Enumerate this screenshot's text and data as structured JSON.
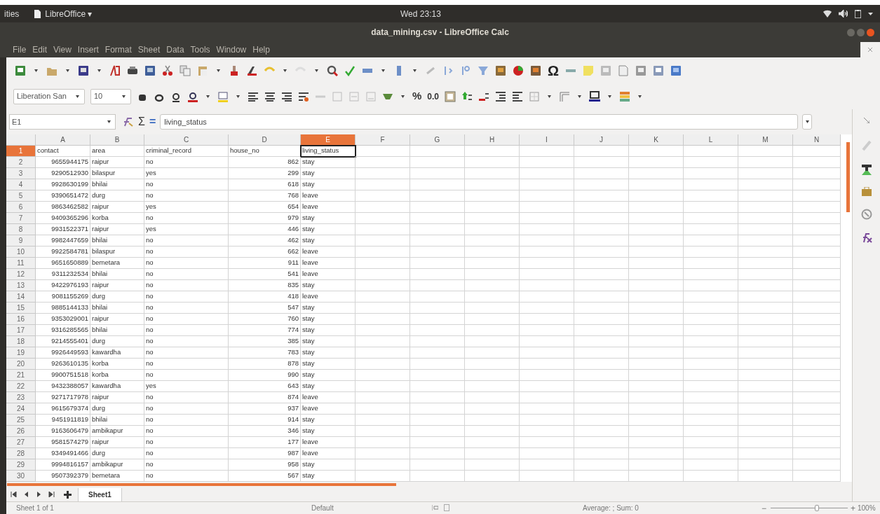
{
  "top_panel": {
    "activities": "ities",
    "app_menu": "LibreOffice ▾",
    "clock": "Wed 23:13"
  },
  "window": {
    "title": "data_mining.csv - LibreOffice Calc"
  },
  "menu": [
    "File",
    "Edit",
    "View",
    "Insert",
    "Format",
    "Sheet",
    "Data",
    "Tools",
    "Window",
    "Help"
  ],
  "toolbar": {
    "special_character": "Ω",
    "font_name": "Liberation San",
    "font_size": "10",
    "percent": "%",
    "decimal": "0.0"
  },
  "formula_bar": {
    "cell_reference": "E1",
    "sum_symbol": "Σ",
    "equals_symbol": "=",
    "content": "living_status"
  },
  "columns": [
    {
      "label": "A",
      "selected": false
    },
    {
      "label": "B",
      "selected": false
    },
    {
      "label": "C",
      "selected": false
    },
    {
      "label": "D",
      "selected": false
    },
    {
      "label": "E",
      "selected": true
    },
    {
      "label": "F",
      "selected": false
    },
    {
      "label": "G",
      "selected": false
    },
    {
      "label": "H",
      "selected": false
    },
    {
      "label": "I",
      "selected": false
    },
    {
      "label": "J",
      "selected": false
    },
    {
      "label": "K",
      "selected": false
    },
    {
      "label": "L",
      "selected": false
    },
    {
      "label": "M",
      "selected": false
    },
    {
      "label": "N",
      "selected": false
    }
  ],
  "rows": [
    {
      "number": "1",
      "selected": true,
      "kind": "header",
      "cells": [
        "contact",
        "area",
        "criminal_record",
        "house_no",
        "living_status"
      ]
    },
    {
      "number": "2",
      "selected": false,
      "kind": "data",
      "cells": [
        "9655944175",
        "raipur",
        "no",
        "862",
        "stay"
      ]
    },
    {
      "number": "3",
      "selected": false,
      "kind": "data",
      "cells": [
        "9290512930",
        "bilaspur",
        "yes",
        "299",
        "stay"
      ]
    },
    {
      "number": "4",
      "selected": false,
      "kind": "data",
      "cells": [
        "9928630199",
        "bhilai",
        "no",
        "618",
        "stay"
      ]
    },
    {
      "number": "5",
      "selected": false,
      "kind": "data",
      "cells": [
        "9390651472",
        "durg",
        "no",
        "768",
        "leave"
      ]
    },
    {
      "number": "6",
      "selected": false,
      "kind": "data",
      "cells": [
        "9863462582",
        "raipur",
        "yes",
        "654",
        "leave"
      ]
    },
    {
      "number": "7",
      "selected": false,
      "kind": "data",
      "cells": [
        "9409365296",
        "korba",
        "no",
        "979",
        "stay"
      ]
    },
    {
      "number": "8",
      "selected": false,
      "kind": "data",
      "cells": [
        "9931522371",
        "raipur",
        "yes",
        "446",
        "stay"
      ]
    },
    {
      "number": "9",
      "selected": false,
      "kind": "data",
      "cells": [
        "9982447659",
        "bhilai",
        "no",
        "462",
        "stay"
      ]
    },
    {
      "number": "10",
      "selected": false,
      "kind": "data",
      "cells": [
        "9922584781",
        "bilaspur",
        "no",
        "662",
        "leave"
      ]
    },
    {
      "number": "11",
      "selected": false,
      "kind": "data",
      "cells": [
        "9651650889",
        "bemetara",
        "no",
        "911",
        "leave"
      ]
    },
    {
      "number": "12",
      "selected": false,
      "kind": "data",
      "cells": [
        "9311232534",
        "bhilai",
        "no",
        "541",
        "leave"
      ]
    },
    {
      "number": "13",
      "selected": false,
      "kind": "data",
      "cells": [
        "9422976193",
        "raipur",
        "no",
        "835",
        "stay"
      ]
    },
    {
      "number": "14",
      "selected": false,
      "kind": "data",
      "cells": [
        "9081155269",
        "durg",
        "no",
        "418",
        "leave"
      ]
    },
    {
      "number": "15",
      "selected": false,
      "kind": "data",
      "cells": [
        "9885144133",
        "bhilai",
        "no",
        "547",
        "stay"
      ]
    },
    {
      "number": "16",
      "selected": false,
      "kind": "data",
      "cells": [
        "9353029001",
        "raipur",
        "no",
        "760",
        "stay"
      ]
    },
    {
      "number": "17",
      "selected": false,
      "kind": "data",
      "cells": [
        "9316285565",
        "bhilai",
        "no",
        "774",
        "stay"
      ]
    },
    {
      "number": "18",
      "selected": false,
      "kind": "data",
      "cells": [
        "9214555401",
        "durg",
        "no",
        "385",
        "stay"
      ]
    },
    {
      "number": "19",
      "selected": false,
      "kind": "data",
      "cells": [
        "9926449593",
        "kawardha",
        "no",
        "783",
        "stay"
      ]
    },
    {
      "number": "20",
      "selected": false,
      "kind": "data",
      "cells": [
        "9263610135",
        "korba",
        "no",
        "878",
        "stay"
      ]
    },
    {
      "number": "21",
      "selected": false,
      "kind": "data",
      "cells": [
        "9900751518",
        "korba",
        "no",
        "990",
        "stay"
      ]
    },
    {
      "number": "22",
      "selected": false,
      "kind": "data",
      "cells": [
        "9432388057",
        "kawardha",
        "yes",
        "643",
        "stay"
      ]
    },
    {
      "number": "23",
      "selected": false,
      "kind": "data",
      "cells": [
        "9271717978",
        "raipur",
        "no",
        "874",
        "leave"
      ]
    },
    {
      "number": "24",
      "selected": false,
      "kind": "data",
      "cells": [
        "9615679374",
        "durg",
        "no",
        "937",
        "leave"
      ]
    },
    {
      "number": "25",
      "selected": false,
      "kind": "data",
      "cells": [
        "9451911819",
        "bhilai",
        "no",
        "914",
        "stay"
      ]
    },
    {
      "number": "26",
      "selected": false,
      "kind": "data",
      "cells": [
        "9163606479",
        "ambikapur",
        "no",
        "346",
        "stay"
      ]
    },
    {
      "number": "27",
      "selected": false,
      "kind": "data",
      "cells": [
        "9581574279",
        "raipur",
        "no",
        "177",
        "leave"
      ]
    },
    {
      "number": "28",
      "selected": false,
      "kind": "data",
      "cells": [
        "9349491466",
        "durg",
        "no",
        "987",
        "leave"
      ]
    },
    {
      "number": "29",
      "selected": false,
      "kind": "data",
      "cells": [
        "9994816157",
        "ambikapur",
        "no",
        "958",
        "stay"
      ]
    },
    {
      "number": "30",
      "selected": false,
      "kind": "data",
      "cells": [
        "9507392379",
        "bemetara",
        "no",
        "567",
        "stay"
      ]
    }
  ],
  "sheet_tabs": [
    {
      "label": "Sheet1",
      "selected": true
    }
  ],
  "status_bar": {
    "sheet": "Sheet 1 of 1",
    "page_style": "Default",
    "selection_summary": "Average: ; Sum: 0",
    "zoom_minus": "−",
    "zoom_plus": "+",
    "zoom_slider": {
      "level": 0.6
    },
    "zoom": "100%"
  }
}
